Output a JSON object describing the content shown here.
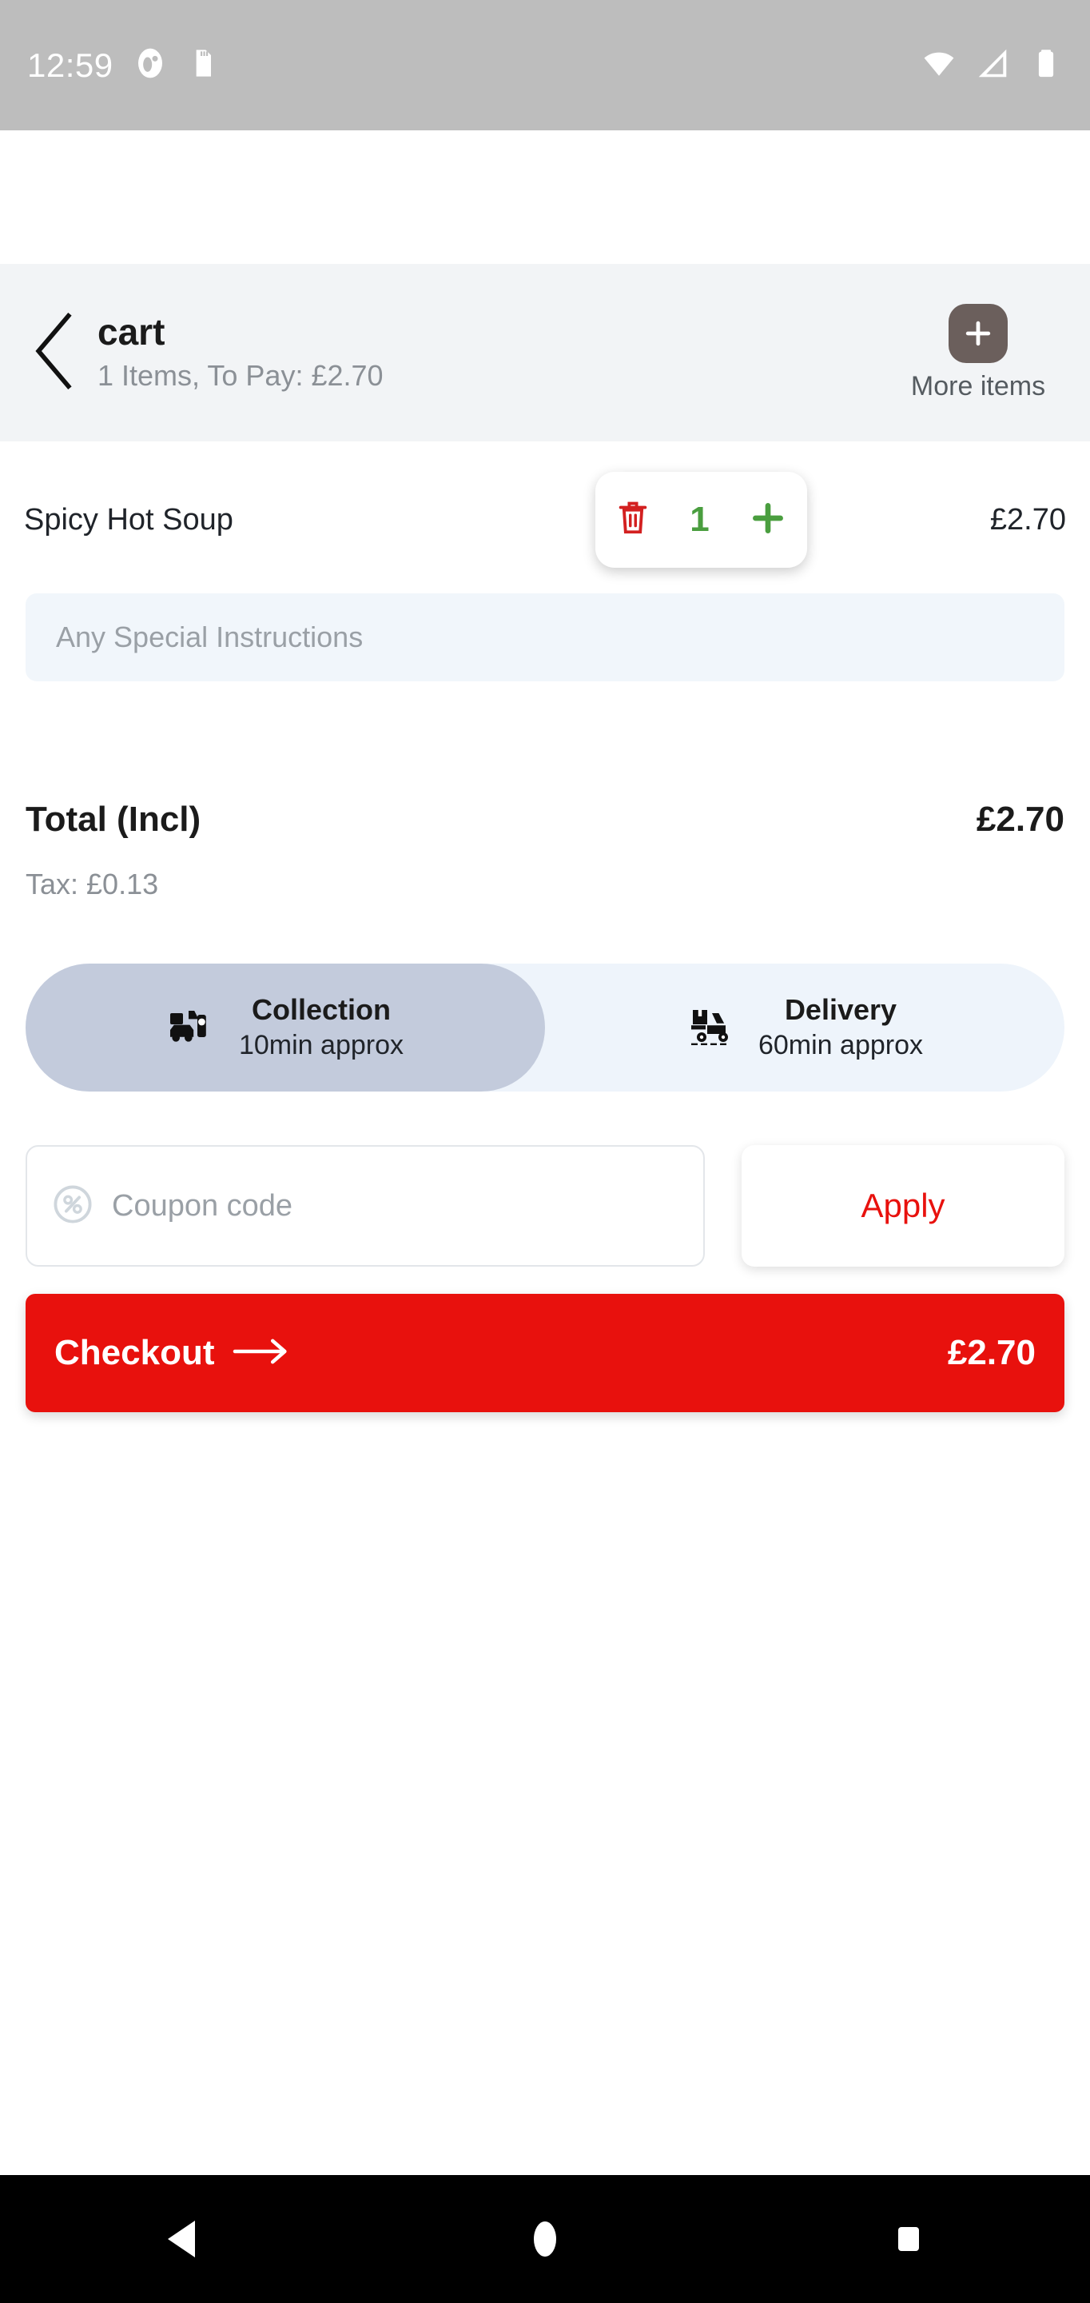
{
  "status_bar": {
    "clock": "12:59",
    "icons_left": [
      "clock-sync-icon",
      "sd-card-icon"
    ],
    "icons_right": [
      "wifi-icon",
      "cell-signal-icon",
      "battery-icon"
    ],
    "background_color": "#bdbdbd"
  },
  "header": {
    "back_icon": "chevron-left-icon",
    "title": "cart",
    "subtitle": "1 Items, To Pay: £2.70",
    "more_items_label": "More items",
    "more_items_icon": "plus-icon",
    "background_color": "#f2f4f6"
  },
  "item": {
    "name": "Spicy Hot Soup",
    "quantity": "1",
    "price": "£2.70",
    "delete_icon": "trash-icon",
    "increment_icon": "plus-icon",
    "quantity_color": "#4a9e3f",
    "delete_color": "#d32020"
  },
  "instructions": {
    "placeholder": "Any Special Instructions",
    "value": ""
  },
  "totals": {
    "total_label": "Total (Incl)",
    "total_value": "£2.70",
    "tax_label": "Tax: £0.13"
  },
  "fulfilment": {
    "options": [
      {
        "label": "Collection",
        "eta": "10min approx",
        "icon": "car-pickup-icon",
        "selected": true
      },
      {
        "label": "Delivery",
        "eta": "60min approx",
        "icon": "scooter-delivery-icon",
        "selected": false
      }
    ],
    "selected_color": "#c3cbdc",
    "track_color": "#eef4fb"
  },
  "coupon": {
    "icon": "percent-circle-icon",
    "placeholder": "Coupon code",
    "value": "",
    "apply_label": "Apply",
    "apply_color": "#e8110d"
  },
  "checkout": {
    "label": "Checkout",
    "arrow_icon": "arrow-right-icon",
    "amount": "£2.70",
    "background_color": "#e8110d"
  },
  "navigation_bar": {
    "back_icon": "nav-back-triangle-icon",
    "home_icon": "nav-home-circle-icon",
    "recents_icon": "nav-recents-square-icon"
  }
}
